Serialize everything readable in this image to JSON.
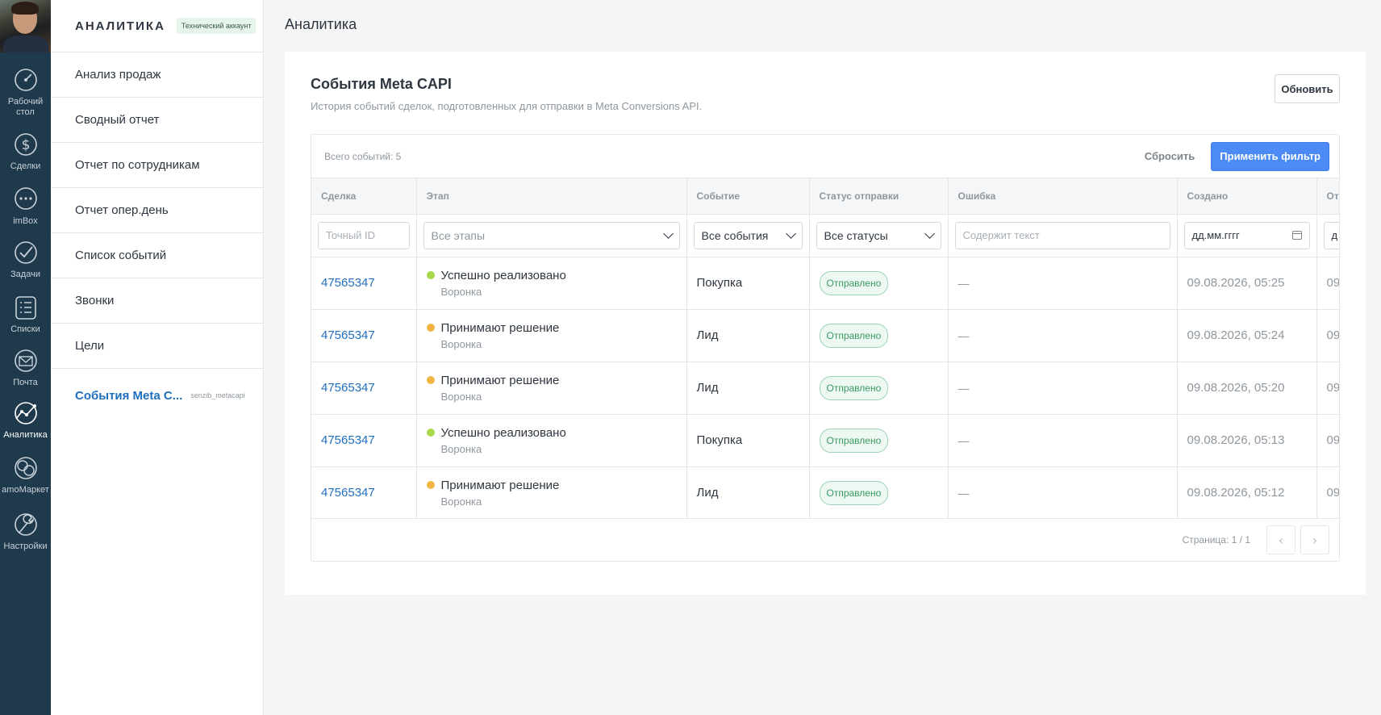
{
  "leftnav": {
    "items": [
      {
        "label": "Рабочий стол",
        "icon": "dashboard-icon"
      },
      {
        "label": "Сделки",
        "icon": "dollar-icon"
      },
      {
        "label": "imBox",
        "icon": "chat-icon"
      },
      {
        "label": "Задачи",
        "icon": "check-icon"
      },
      {
        "label": "Списки",
        "icon": "list-icon"
      },
      {
        "label": "Почта",
        "icon": "mail-icon"
      },
      {
        "label": "Аналитика",
        "icon": "analytics-icon"
      },
      {
        "label": "amoМаркет",
        "icon": "market-icon"
      },
      {
        "label": "Настройки",
        "icon": "wrench-icon"
      }
    ]
  },
  "sidebar": {
    "title": "АНАЛИТИКА",
    "badge": "Технический аккаунт",
    "items": [
      {
        "label": "Анализ продаж"
      },
      {
        "label": "Сводный отчет"
      },
      {
        "label": "Отчет по сотрудникам"
      },
      {
        "label": "Отчет опер.день"
      },
      {
        "label": "Список событий"
      },
      {
        "label": "Звонки"
      },
      {
        "label": "Цели"
      }
    ],
    "active_item": {
      "label": "События Meta C...",
      "sub": "senzib_metacapi"
    }
  },
  "header": {
    "title": "Аналитика"
  },
  "card": {
    "title": "События Meta CAPI",
    "subtitle": "История событий сделок, подготовленных для отправки в Meta Conversions API.",
    "refresh_label": "Обновить"
  },
  "panel": {
    "total": "Всего событий: 5",
    "reset_label": "Сбросить",
    "apply_label": "Применить фильтр"
  },
  "table": {
    "columns": [
      "Сделка",
      "Этап",
      "Событие",
      "Статус отправки",
      "Ошибка",
      "Создано",
      "От"
    ],
    "filters": {
      "deal_placeholder": "Точный ID",
      "stage_value": "Все этапы",
      "event_value": "Все события",
      "status_value": "Все статусы",
      "error_placeholder": "Содержит текст",
      "created_placeholder": "дд.мм.гггг",
      "sent_placeholder_clip": "д"
    },
    "rows": [
      {
        "deal": "47565347",
        "stage": "Успешно реализовано",
        "stage_color": "#a6d84a",
        "pipeline": "Воронка",
        "event": "Покупка",
        "status": "Отправлено",
        "error": "—",
        "created": "09.08.2026, 05:25",
        "sent_clip": "09"
      },
      {
        "deal": "47565347",
        "stage": "Принимают решение",
        "stage_color": "#f2b544",
        "pipeline": "Воронка",
        "event": "Лид",
        "status": "Отправлено",
        "error": "—",
        "created": "09.08.2026, 05:24",
        "sent_clip": "09"
      },
      {
        "deal": "47565347",
        "stage": "Принимают решение",
        "stage_color": "#f2b544",
        "pipeline": "Воронка",
        "event": "Лид",
        "status": "Отправлено",
        "error": "—",
        "created": "09.08.2026, 05:20",
        "sent_clip": "09"
      },
      {
        "deal": "47565347",
        "stage": "Успешно реализовано",
        "stage_color": "#a6d84a",
        "pipeline": "Воронка",
        "event": "Покупка",
        "status": "Отправлено",
        "error": "—",
        "created": "09.08.2026, 05:13",
        "sent_clip": "09"
      },
      {
        "deal": "47565347",
        "stage": "Принимают решение",
        "stage_color": "#f2b544",
        "pipeline": "Воронка",
        "event": "Лид",
        "status": "Отправлено",
        "error": "—",
        "created": "09.08.2026, 05:12",
        "sent_clip": "09"
      }
    ]
  },
  "pager": {
    "info": "Страница: 1 / 1",
    "prev": "‹",
    "next": "›"
  }
}
